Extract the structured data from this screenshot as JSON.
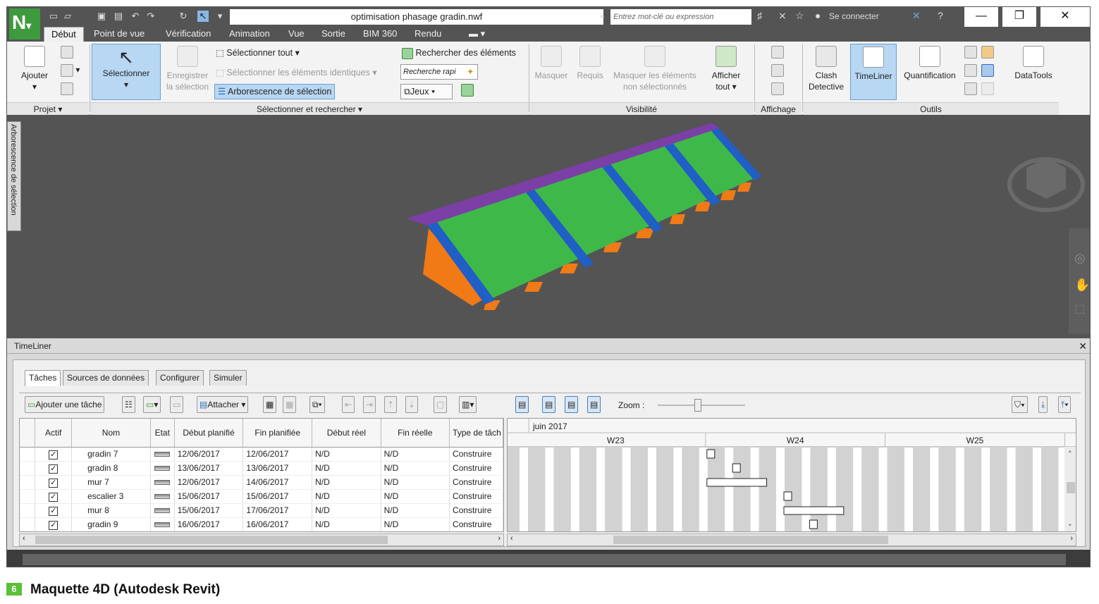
{
  "app": {
    "logo": "N",
    "doc_title": "optimisation phasage gradin.nwf",
    "search_placeholder": "Entrez mot-clé ou expression",
    "signin": "Se connecter"
  },
  "menu_tabs": [
    "Début",
    "Point de vue",
    "Vérification",
    "Animation",
    "Vue",
    "Sortie",
    "BIM 360",
    "Rendu"
  ],
  "ribbon": {
    "ajouter": "Ajouter",
    "selectionner": "Sélectionner",
    "enregistrer1": "Enregistrer",
    "enregistrer2": "la sélection",
    "sel_tout": "Sélectionner tout",
    "sel_identiques": "Sélectionner les éléments identiques",
    "arborescence": "Arborescence de sélection",
    "rechercher": "Rechercher des éléments",
    "recherche_rapide": "Recherche rapi",
    "jeux": "Jeux",
    "masquer": "Masquer",
    "requis": "Requis",
    "masquer_ns1": "Masquer les éléments",
    "masquer_ns2": "non sélectionnés",
    "afficher1": "Afficher",
    "afficher2": "tout",
    "clash1": "Clash",
    "clash2": "Detective",
    "timeliner": "TimeLiner",
    "quantification": "Quantification",
    "datatools": "DataTools",
    "groups": {
      "projet": "Projet",
      "sel": "Sélectionner et rechercher",
      "visibilite": "Visibilité",
      "affichage": "Affichage",
      "outils": "Outils"
    }
  },
  "viewport": {
    "side_panel": "Arborescence de sélection"
  },
  "timeliner": {
    "title": "TimeLiner",
    "tabs": [
      "Tâches",
      "Sources de données",
      "Configurer",
      "Simuler"
    ],
    "toolbar": {
      "add_task": "Ajouter une tâche",
      "attach": "Attacher",
      "zoom": "Zoom :"
    },
    "columns": [
      "Actif",
      "Nom",
      "Etat",
      "Début planifié",
      "Fin planifiée",
      "Début réel",
      "Fin réelle",
      "Type de tâch"
    ],
    "rows": [
      {
        "nom": "gradin 7",
        "debut": "12/06/2017",
        "fin": "12/06/2017",
        "debut_reel": "N/D",
        "fin_reelle": "N/D",
        "type": "Construire"
      },
      {
        "nom": "gradin 8",
        "debut": "13/06/2017",
        "fin": "13/06/2017",
        "debut_reel": "N/D",
        "fin_reelle": "N/D",
        "type": "Construire"
      },
      {
        "nom": "mur 7",
        "debut": "12/06/2017",
        "fin": "14/06/2017",
        "debut_reel": "N/D",
        "fin_reelle": "N/D",
        "type": "Construire"
      },
      {
        "nom": "escalier 3",
        "debut": "15/06/2017",
        "fin": "15/06/2017",
        "debut_reel": "N/D",
        "fin_reelle": "N/D",
        "type": "Construire"
      },
      {
        "nom": "mur 8",
        "debut": "15/06/2017",
        "fin": "17/06/2017",
        "debut_reel": "N/D",
        "fin_reelle": "N/D",
        "type": "Construire"
      },
      {
        "nom": "gradin 9",
        "debut": "16/06/2017",
        "fin": "16/06/2017",
        "debut_reel": "N/D",
        "fin_reelle": "N/D",
        "type": "Construire"
      }
    ],
    "gantt": {
      "month": "juin 2017",
      "weeks": [
        "W23",
        "W24",
        "W25"
      ]
    }
  },
  "caption": {
    "num": "6",
    "text": "Maquette 4D (Autodesk Revit)"
  },
  "colors": {
    "frame": "#535353",
    "green_model": "#3fb84a",
    "blue_model": "#1f5fc6",
    "purple_model": "#7b3fa6",
    "orange_model": "#f07a16",
    "accent": "#3d9a3d"
  }
}
